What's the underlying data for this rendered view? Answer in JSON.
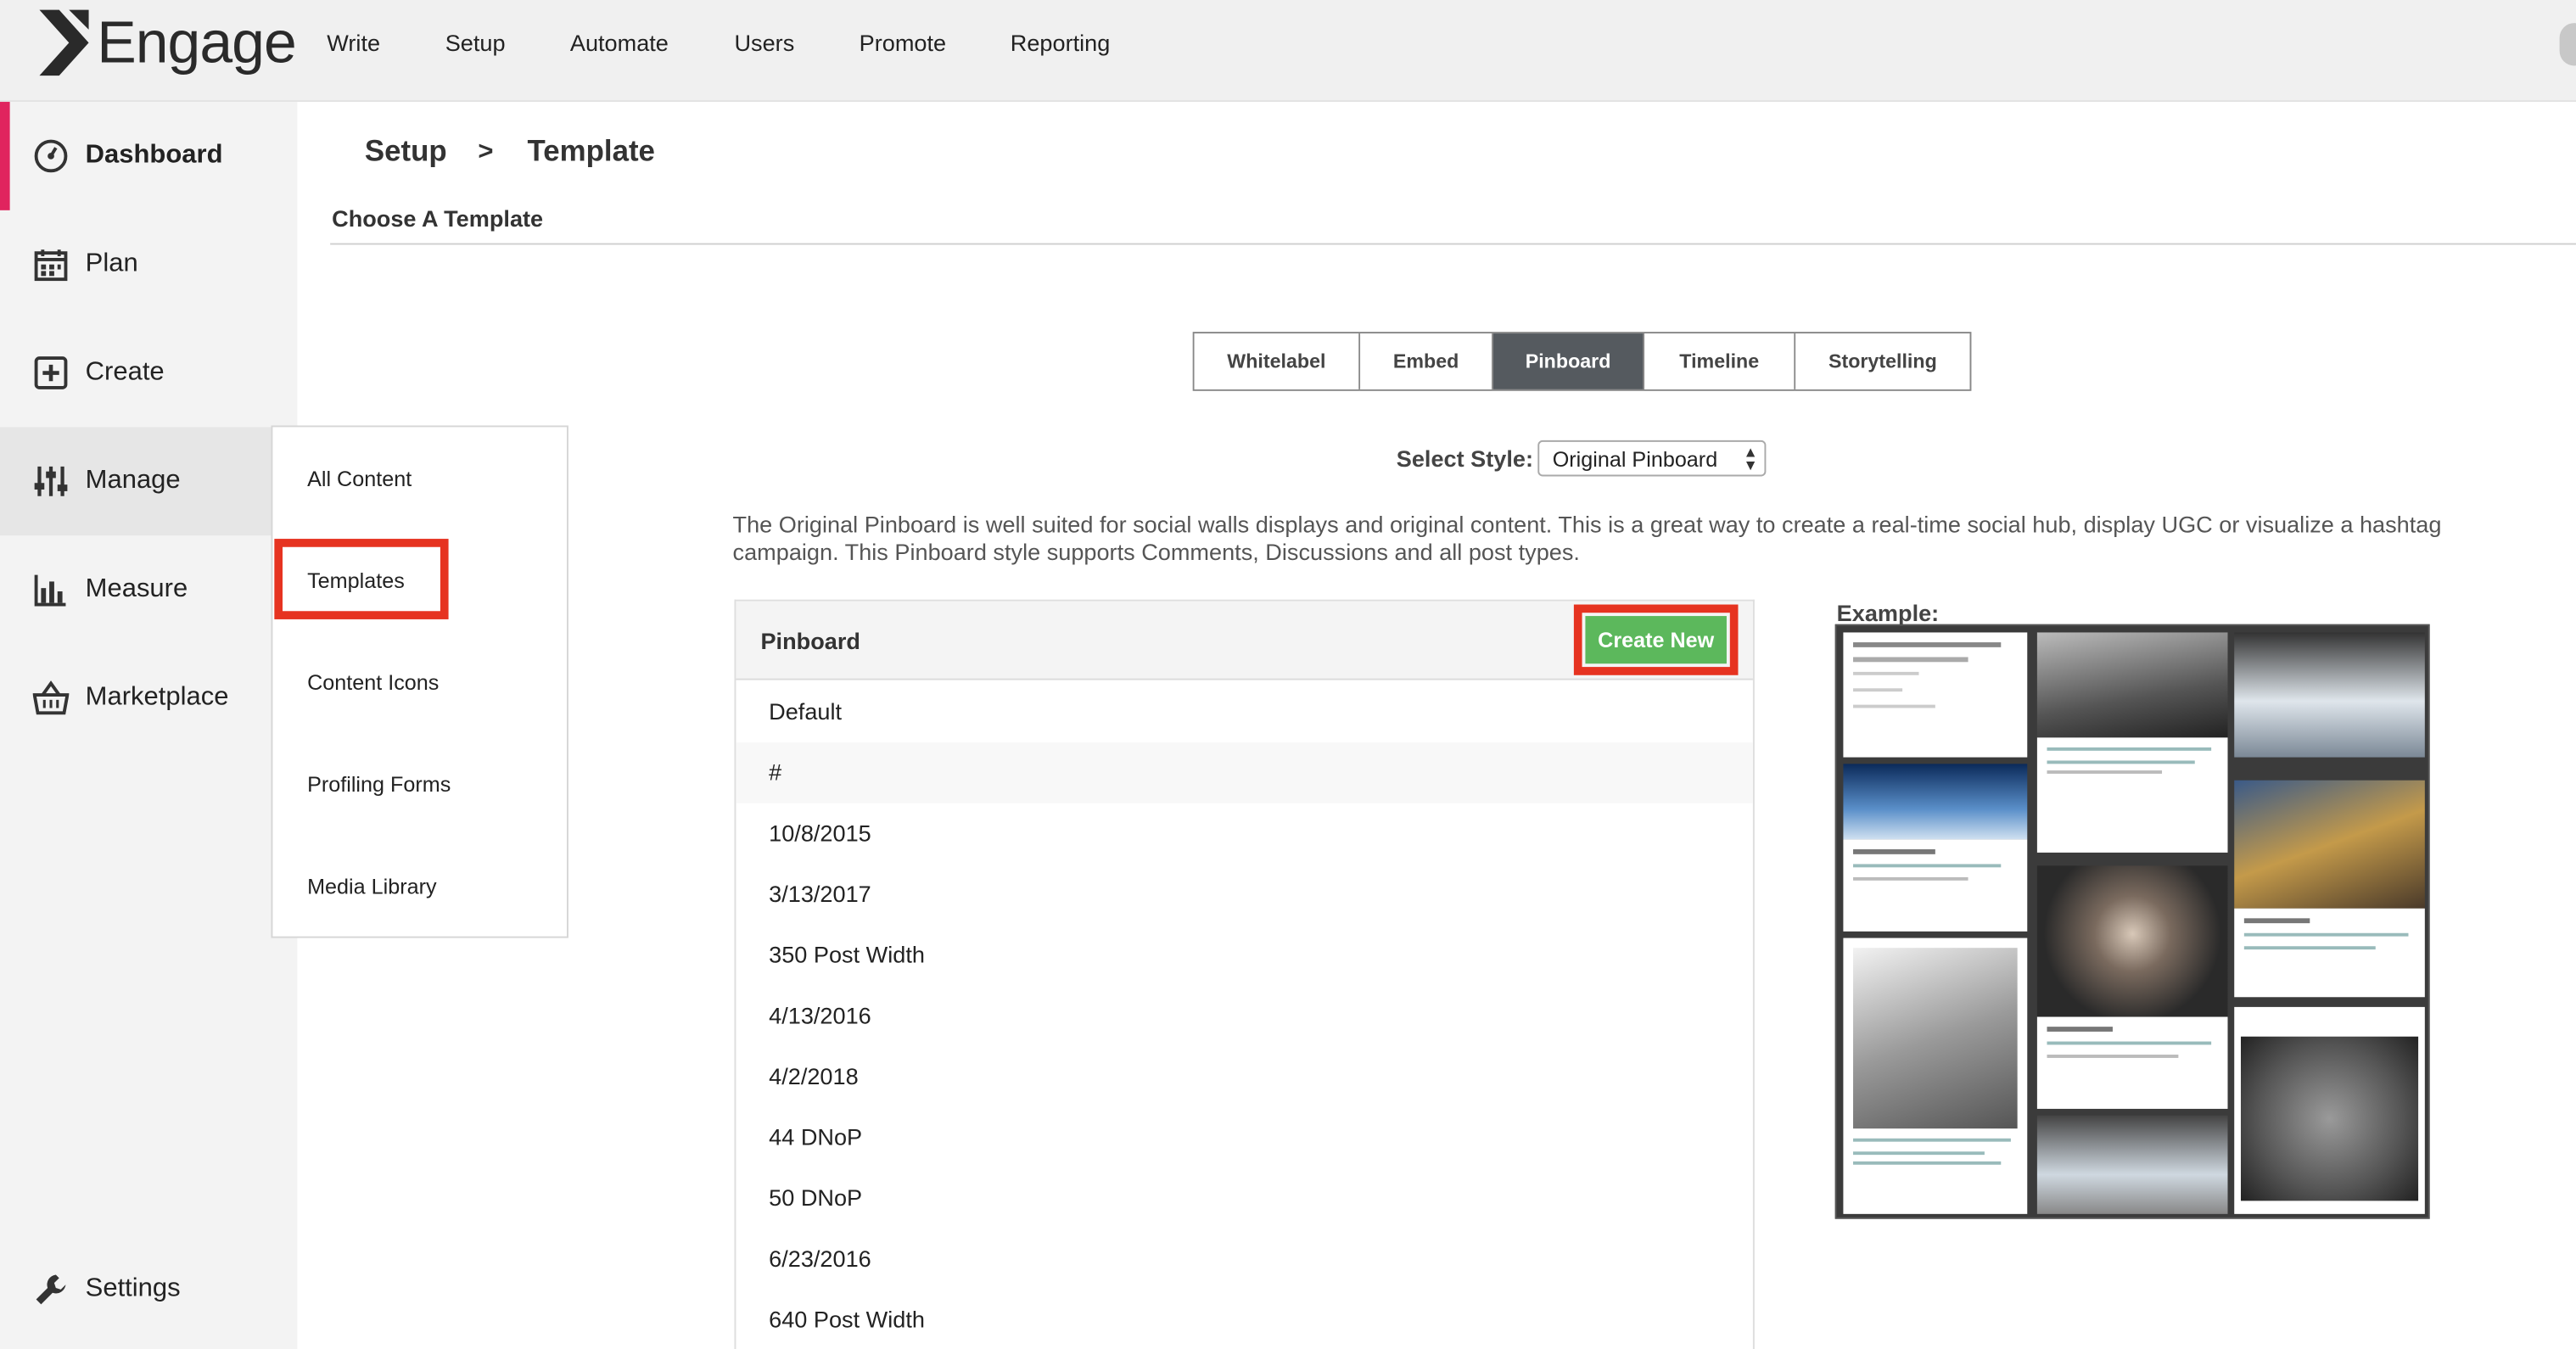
{
  "app": {
    "name": "Engage"
  },
  "topnav": [
    "Write",
    "Setup",
    "Automate",
    "Users",
    "Promote",
    "Reporting"
  ],
  "sidebar": {
    "items": [
      {
        "label": "Dashboard",
        "icon": "dashboard-gauge-icon"
      },
      {
        "label": "Plan",
        "icon": "calendar-icon"
      },
      {
        "label": "Create",
        "icon": "plus-square-icon"
      },
      {
        "label": "Manage",
        "icon": "sliders-icon"
      },
      {
        "label": "Measure",
        "icon": "bar-chart-icon"
      },
      {
        "label": "Marketplace",
        "icon": "basket-icon"
      },
      {
        "label": "Settings",
        "icon": "wrench-icon"
      }
    ],
    "active": "Dashboard"
  },
  "manage_menu": {
    "items": [
      "All Content",
      "Templates",
      "Content Icons",
      "Profiling Forms",
      "Media Library"
    ],
    "highlighted": "Templates"
  },
  "breadcrumb": {
    "parent": "Setup",
    "separator": ">",
    "current": "Template"
  },
  "section_title": "Choose A Template",
  "tabs": {
    "items": [
      "Whitelabel",
      "Embed",
      "Pinboard",
      "Timeline",
      "Storytelling"
    ],
    "active": "Pinboard"
  },
  "style": {
    "label": "Select Style:",
    "value": "Original Pinboard"
  },
  "description": "The Original Pinboard is well suited for social walls displays and original content. This is a great way to create a real-time social hub, display UGC or visualize a hashtag campaign. This Pinboard style supports Comments, Discussions and all post types.",
  "panel": {
    "title": "Pinboard",
    "create_label": "Create New",
    "rows": [
      "Default",
      "#",
      "10/8/2015",
      "3/13/2017",
      "350 Post Width",
      "4/13/2016",
      "4/2/2018",
      "44 DNoP",
      "50 DNoP",
      "6/23/2016",
      "640 Post Width"
    ]
  },
  "example": {
    "label": "Example:"
  },
  "colors": {
    "accent": "#e0245e",
    "highlight": "#e63320",
    "create": "#5cb85c",
    "active_tab": "#555a5f"
  }
}
